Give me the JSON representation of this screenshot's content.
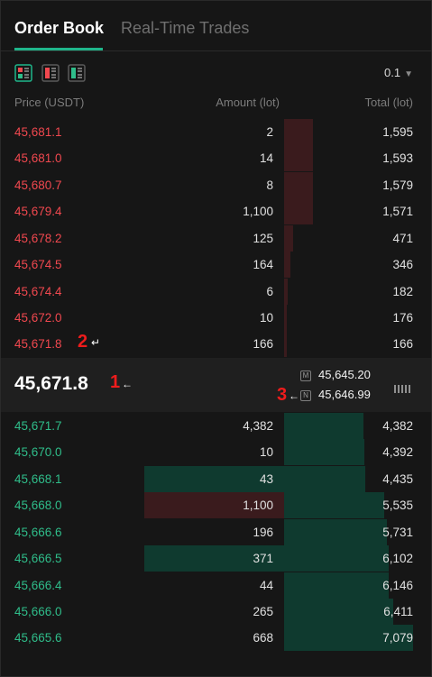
{
  "tabs": [
    {
      "label": "Order Book"
    },
    {
      "label": "Real-Time Trades"
    }
  ],
  "toolbar": {
    "view_icons": [
      "order-book-both-icon",
      "order-book-asks-icon",
      "order-book-bids-icon"
    ],
    "precision": "0.1"
  },
  "headers": {
    "price": "Price (USDT)",
    "amount": "Amount (lot)",
    "total": "Total (lot)"
  },
  "asks": [
    {
      "price": "45,681.1",
      "amount": "2",
      "total": "1,595"
    },
    {
      "price": "45,681.0",
      "amount": "14",
      "total": "1,593"
    },
    {
      "price": "45,680.7",
      "amount": "8",
      "total": "1,579"
    },
    {
      "price": "45,679.4",
      "amount": "1,100",
      "total": "1,571"
    },
    {
      "price": "45,678.2",
      "amount": "125",
      "total": "471"
    },
    {
      "price": "45,674.5",
      "amount": "164",
      "total": "346"
    },
    {
      "price": "45,674.4",
      "amount": "6",
      "total": "182"
    },
    {
      "price": "45,672.0",
      "amount": "10",
      "total": "176"
    },
    {
      "price": "45,671.8",
      "amount": "166",
      "total": "166"
    }
  ],
  "mid": {
    "last_price": "45,671.8",
    "mark_badge": "M",
    "mark_price": "45,645.20",
    "index_badge": "N",
    "index_price": "45,646.99"
  },
  "bids": [
    {
      "price": "45,671.7",
      "amount": "4,382",
      "total": "4,382"
    },
    {
      "price": "45,670.0",
      "amount": "10",
      "total": "4,392"
    },
    {
      "price": "45,668.1",
      "amount": "43",
      "total": "4,435"
    },
    {
      "price": "45,668.0",
      "amount": "1,100",
      "total": "5,535"
    },
    {
      "price": "45,666.6",
      "amount": "196",
      "total": "5,731"
    },
    {
      "price": "45,666.5",
      "amount": "371",
      "total": "6,102"
    },
    {
      "price": "45,666.4",
      "amount": "44",
      "total": "6,146"
    },
    {
      "price": "45,666.0",
      "amount": "265",
      "total": "6,411"
    },
    {
      "price": "45,665.6",
      "amount": "668",
      "total": "7,079"
    }
  ],
  "annotations": {
    "one": "1",
    "two": "2",
    "three": "3",
    "arrow_left": "←",
    "arrow_return": "↵"
  },
  "colors": {
    "ask": "#f0484f",
    "bid": "#2fbd8a",
    "accent": "#1fb58a"
  }
}
